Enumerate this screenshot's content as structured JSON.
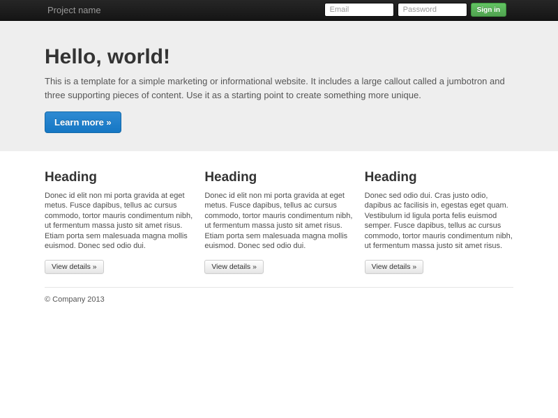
{
  "navbar": {
    "brand": "Project name",
    "form": {
      "email_placeholder": "Email",
      "password_placeholder": "Password",
      "signin_label": "Sign in"
    }
  },
  "jumbotron": {
    "title": "Hello, world!",
    "description": "This is a template for a simple marketing or informational website. It includes a large callout called a jumbotron and three supporting pieces of content. Use it as a starting point to create something more unique.",
    "cta_label": "Learn more »"
  },
  "columns": [
    {
      "heading": "Heading",
      "body": "Donec id elit non mi porta gravida at eget metus. Fusce dapibus, tellus ac cursus commodo, tortor mauris condimentum nibh, ut fermentum massa justo sit amet risus. Etiam porta sem malesuada magna mollis euismod. Donec sed odio dui.",
      "button_label": "View details »"
    },
    {
      "heading": "Heading",
      "body": "Donec id elit non mi porta gravida at eget metus. Fusce dapibus, tellus ac cursus commodo, tortor mauris condimentum nibh, ut fermentum massa justo sit amet risus. Etiam porta sem malesuada magna mollis euismod. Donec sed odio dui.",
      "button_label": "View details »"
    },
    {
      "heading": "Heading",
      "body": "Donec sed odio dui. Cras justo odio, dapibus ac facilisis in, egestas eget quam. Vestibulum id ligula porta felis euismod semper. Fusce dapibus, tellus ac cursus commodo, tortor mauris condimentum nibh, ut fermentum massa justo sit amet risus.",
      "button_label": "View details »"
    }
  ],
  "footer": {
    "copyright": "© Company 2013"
  },
  "colors": {
    "navbar_bg": "#1b1b1b",
    "navbar_brand": "#999999",
    "jumbotron_bg": "#eeeeee",
    "primary_button": "#1f7fc9",
    "signin_button": "#5bb75b",
    "heading_text": "#333333",
    "body_text": "#555555"
  }
}
